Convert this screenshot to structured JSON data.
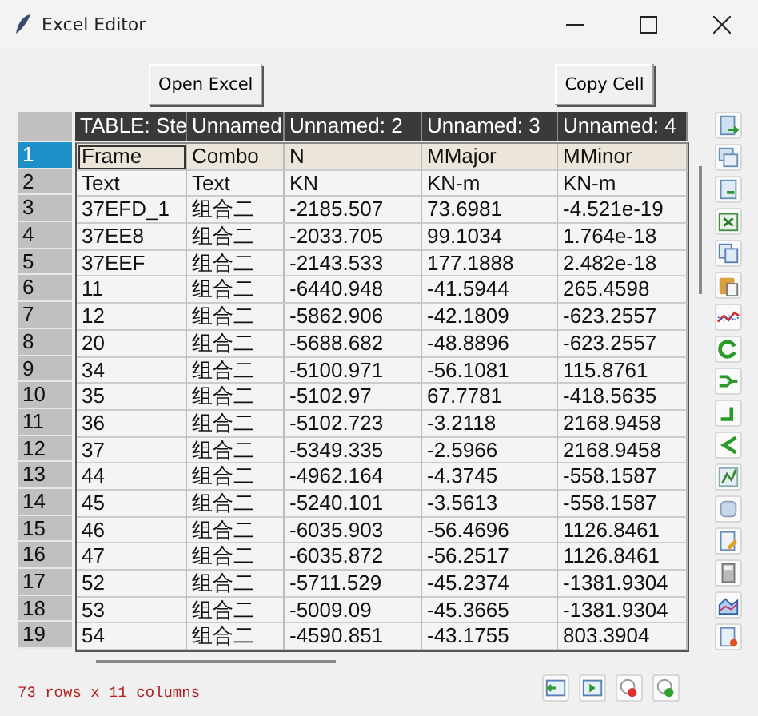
{
  "window": {
    "title": "Excel Editor"
  },
  "buttons": [
    {
      "label": "Open Excel"
    },
    {
      "label": "Copy Cell"
    }
  ],
  "table": {
    "columns": [
      "TABLE:  Ste",
      "Unnamed:",
      "Unnamed: 2",
      "Unnamed: 3",
      "Unnamed: 4"
    ],
    "rows": [
      {
        "index": "1",
        "selected": true,
        "cells": [
          "Frame",
          "Combo",
          "N",
          "MMajor",
          "MMinor"
        ]
      },
      {
        "index": "2",
        "selected": false,
        "cells": [
          "Text",
          "Text",
          "KN",
          "KN-m",
          "KN-m"
        ]
      },
      {
        "index": "3",
        "selected": false,
        "cells": [
          "37EFD_1",
          "组合二",
          "-2185.507",
          "73.6981",
          "-4.521e-19"
        ]
      },
      {
        "index": "4",
        "selected": false,
        "cells": [
          "37EE8",
          "组合二",
          "-2033.705",
          "99.1034",
          "1.764e-18"
        ]
      },
      {
        "index": "5",
        "selected": false,
        "cells": [
          "37EEF",
          "组合二",
          "-2143.533",
          "177.1888",
          "2.482e-18"
        ]
      },
      {
        "index": "6",
        "selected": false,
        "cells": [
          "11",
          "组合二",
          "-6440.948",
          "-41.5944",
          "265.4598"
        ]
      },
      {
        "index": "7",
        "selected": false,
        "cells": [
          "12",
          "组合二",
          "-5862.906",
          "-42.1809",
          "-623.2557"
        ]
      },
      {
        "index": "8",
        "selected": false,
        "cells": [
          "20",
          "组合二",
          "-5688.682",
          "-48.8896",
          "-623.2557"
        ]
      },
      {
        "index": "9",
        "selected": false,
        "cells": [
          "34",
          "组合二",
          "-5100.971",
          "-56.1081",
          "115.8761"
        ]
      },
      {
        "index": "10",
        "selected": false,
        "cells": [
          "35",
          "组合二",
          "-5102.97",
          "67.7781",
          "-418.5635"
        ]
      },
      {
        "index": "11",
        "selected": false,
        "cells": [
          "36",
          "组合二",
          "-5102.723",
          "-3.2118",
          "2168.9458"
        ]
      },
      {
        "index": "12",
        "selected": false,
        "cells": [
          "37",
          "组合二",
          "-5349.335",
          "-2.5966",
          "2168.9458"
        ]
      },
      {
        "index": "13",
        "selected": false,
        "cells": [
          "44",
          "组合二",
          "-4962.164",
          "-4.3745",
          "-558.1587"
        ]
      },
      {
        "index": "14",
        "selected": false,
        "cells": [
          "45",
          "组合二",
          "-5240.101",
          "-3.5613",
          "-558.1587"
        ]
      },
      {
        "index": "15",
        "selected": false,
        "cells": [
          "46",
          "组合二",
          "-6035.903",
          "-56.4696",
          "1126.8461"
        ]
      },
      {
        "index": "16",
        "selected": false,
        "cells": [
          "47",
          "组合二",
          "-6035.872",
          "-56.2517",
          "1126.8461"
        ]
      },
      {
        "index": "17",
        "selected": false,
        "cells": [
          "52",
          "组合二",
          "-5711.529",
          "-45.2374",
          "-1381.9304"
        ]
      },
      {
        "index": "18",
        "selected": false,
        "cells": [
          "53",
          "组合二",
          "-5009.09",
          "-45.3665",
          "-1381.9304"
        ]
      },
      {
        "index": "19",
        "selected": false,
        "cells": [
          "54",
          "组合二",
          "-4590.851",
          "-43.1755",
          "803.3904"
        ]
      }
    ]
  },
  "status_bar": {
    "text": "73 rows x 11 columns"
  }
}
